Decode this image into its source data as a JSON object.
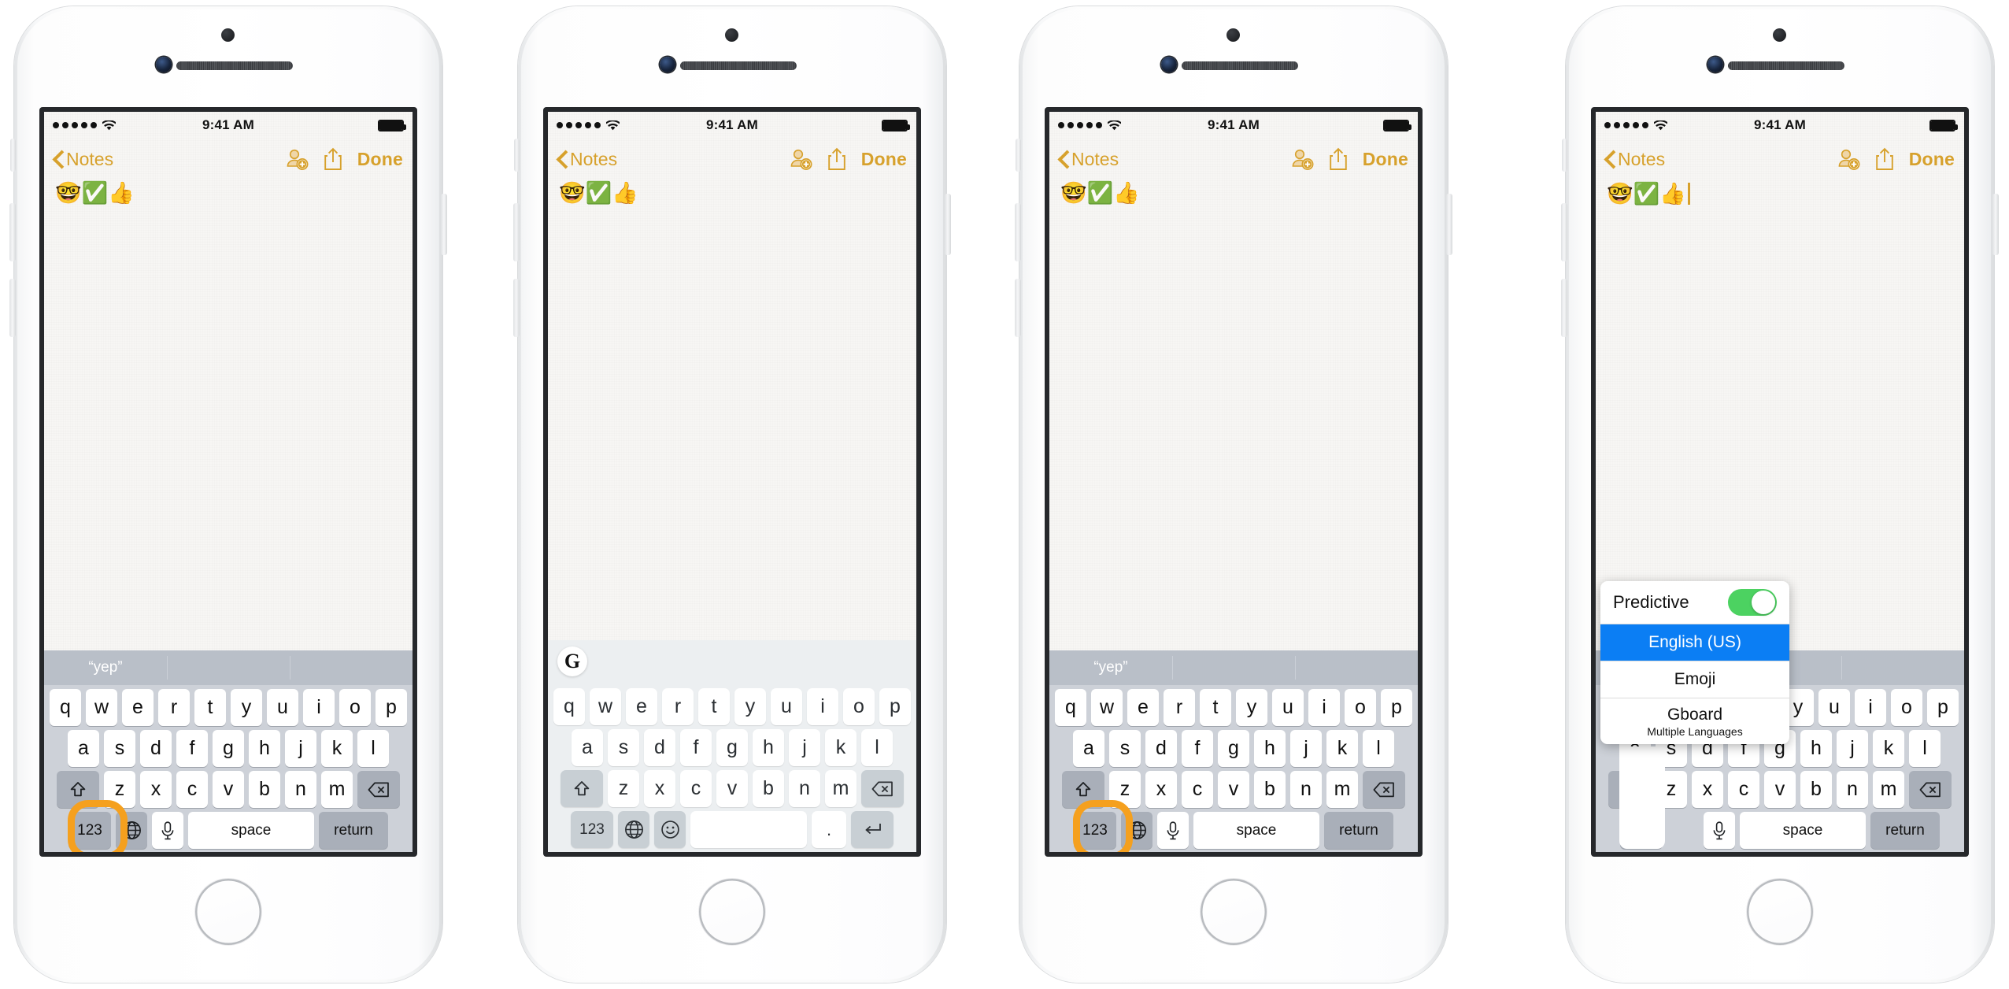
{
  "meta": {
    "caption": "iOS Notes app keyboard switching sequence across four iPhone screenshots",
    "accent_gold": "#d7a12c",
    "highlight_orange": "#F5A01E",
    "toggle_green": "#4cd261",
    "selection_blue": "#0b7ef4"
  },
  "status_bar": {
    "signal_dots": 5,
    "wifi_icon": "wifi-icon",
    "time": "9:41 AM",
    "battery_icon": "battery-full-icon"
  },
  "navbar": {
    "back_label": "Notes",
    "back_icon": "chevron-left-icon",
    "add_person_icon": "person-add-icon",
    "share_icon": "share-icon",
    "done_label": "Done"
  },
  "note": {
    "content": "🤓✅👍",
    "cursor_visible_on": 4,
    "add_button_icon": "plus-circle-icon"
  },
  "ios_keyboard": {
    "suggestions": [
      "“yep”",
      "",
      ""
    ],
    "rows": [
      [
        "q",
        "w",
        "e",
        "r",
        "t",
        "y",
        "u",
        "i",
        "o",
        "p"
      ],
      [
        "a",
        "s",
        "d",
        "f",
        "g",
        "h",
        "j",
        "k",
        "l"
      ],
      [
        "z",
        "x",
        "c",
        "v",
        "b",
        "n",
        "m"
      ]
    ],
    "shift_icon": "shift-up-icon",
    "backspace_icon": "backspace-delete-icon",
    "numbers_label": "123",
    "globe_icon": "globe-language-icon",
    "mic_icon": "microphone-icon",
    "space_label": "space",
    "return_label": "return"
  },
  "gboard_keyboard": {
    "logo_label": "G",
    "logo_name": "gboard-logo-icon",
    "rows": [
      [
        "q",
        "w",
        "e",
        "r",
        "t",
        "y",
        "u",
        "i",
        "o",
        "p"
      ],
      [
        "a",
        "s",
        "d",
        "f",
        "g",
        "h",
        "j",
        "k",
        "l"
      ],
      [
        "z",
        "x",
        "c",
        "v",
        "b",
        "n",
        "m"
      ]
    ],
    "shift_icon": "shift-up-icon",
    "backspace_icon": "backspace-delete-icon",
    "numbers_label": "123",
    "globe_icon": "globe-language-icon",
    "emoji_icon": "emoji-smiley-icon",
    "space_label": "",
    "period_label": ".",
    "enter_icon": "enter-return-arrow-icon"
  },
  "keyboard_popup": {
    "predictive_label": "Predictive",
    "predictive_enabled": true,
    "items": [
      {
        "label": "English (US)",
        "selected": true,
        "sub": ""
      },
      {
        "label": "Emoji",
        "selected": false,
        "sub": ""
      },
      {
        "label": "Gboard",
        "selected": false,
        "sub": "Multiple Languages"
      }
    ]
  },
  "phones": [
    {
      "index": 1,
      "keyboard": "ios",
      "highlight": "globe-key",
      "popup": false
    },
    {
      "index": 2,
      "keyboard": "gboard",
      "highlight": "none",
      "popup": false
    },
    {
      "index": 3,
      "keyboard": "ios",
      "highlight": "globe-key",
      "popup": false
    },
    {
      "index": 4,
      "keyboard": "ios",
      "highlight": "none",
      "popup": true
    }
  ]
}
